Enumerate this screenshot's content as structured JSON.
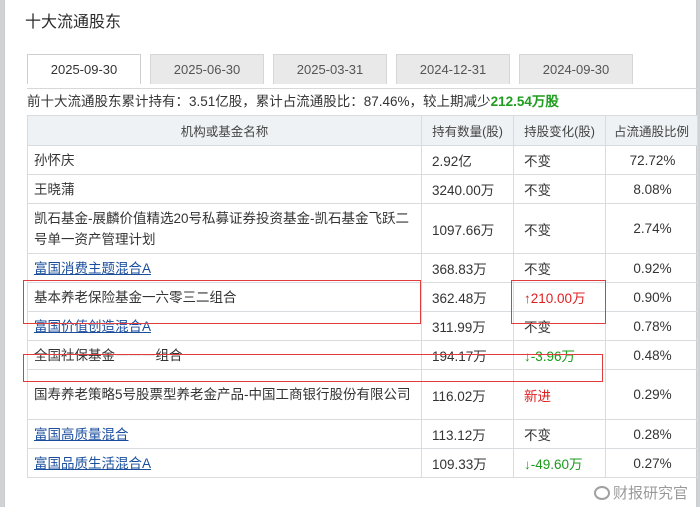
{
  "title": "十大流通股东",
  "tabs": [
    {
      "label": "2025-09-30",
      "active": true
    },
    {
      "label": "2025-06-30",
      "active": false
    },
    {
      "label": "2025-03-31",
      "active": false
    },
    {
      "label": "2024-12-31",
      "active": false
    },
    {
      "label": "2024-09-30",
      "active": false
    }
  ],
  "summary": {
    "prefix": "前十大流通股东累计持有：3.51亿股，累计占流通股比：87.46%，较上期减少",
    "change": "212.54万股"
  },
  "table": {
    "headers": [
      "机构或基金名称",
      "持有数量(股)",
      "持股变化(股)",
      "占流通股比例"
    ],
    "rows": [
      {
        "name": "孙怀庆",
        "qty": "2.92亿",
        "change": "不变",
        "change_type": "same",
        "ratio": "72.72%",
        "link": false
      },
      {
        "name": "王晓蒲",
        "qty": "3240.00万",
        "change": "不变",
        "change_type": "same",
        "ratio": "8.08%",
        "link": false
      },
      {
        "name": "凯石基金-展麟价值精选20号私募证券投资基金-凯石基金飞跃二号单一资产管理计划",
        "qty": "1097.66万",
        "change": "不变",
        "change_type": "same",
        "ratio": "2.74%",
        "link": false
      },
      {
        "name": "富国消费主题混合A",
        "qty": "368.83万",
        "change": "不变",
        "change_type": "same",
        "ratio": "0.92%",
        "link": true
      },
      {
        "name": "基本养老保险基金一六零三二组合",
        "qty": "362.48万",
        "change": "210.00万",
        "change_type": "up",
        "ratio": "0.90%",
        "link": false
      },
      {
        "name": "富国价值创造混合A",
        "qty": "311.99万",
        "change": "不变",
        "change_type": "same",
        "ratio": "0.78%",
        "link": true
      },
      {
        "name": "全国社保基金一一一组合",
        "qty": "194.17万",
        "change": "-3.96万",
        "change_type": "down",
        "ratio": "0.48%",
        "link": false
      },
      {
        "name": "国寿养老策略5号股票型养老金产品-中国工商银行股份有限公司",
        "qty": "116.02万",
        "change": "新进",
        "change_type": "new",
        "ratio": "0.29%",
        "link": false
      },
      {
        "name": "富国高质量混合",
        "qty": "113.12万",
        "change": "不变",
        "change_type": "same",
        "ratio": "0.28%",
        "link": true
      },
      {
        "name": "富国品质生活混合A",
        "qty": "109.33万",
        "change": "-49.60万",
        "change_type": "down",
        "ratio": "0.27%",
        "link": true
      }
    ]
  },
  "watermark": "财报研究官",
  "colors": {
    "up": "#e02020",
    "down": "#1a9a1a",
    "link": "#1a4d9c",
    "highlight": "#e23b3b"
  }
}
